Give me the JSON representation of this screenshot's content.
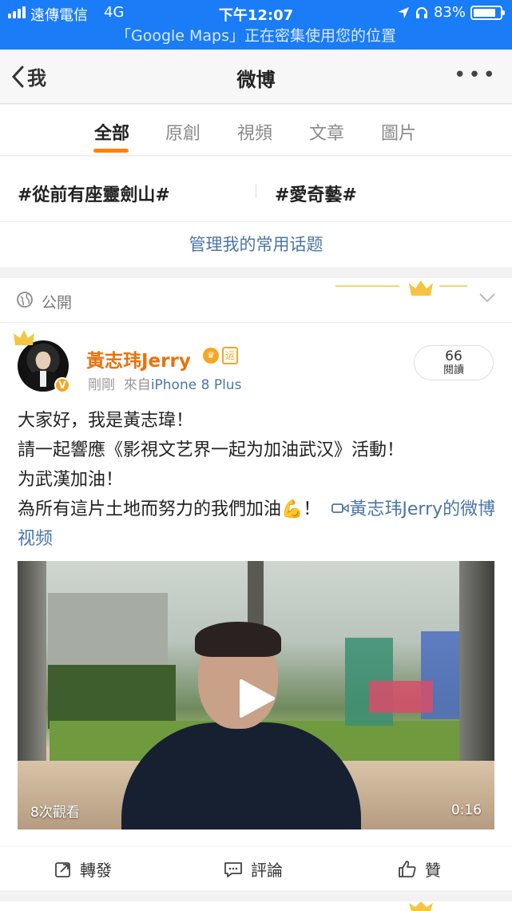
{
  "status_bar": {
    "carrier": "遠傳電信",
    "network": "4G",
    "time": "下午12:07",
    "battery_text": "83%",
    "battery_level": 0.83,
    "location_banner": "「Google Maps」正在密集使用您的位置"
  },
  "nav": {
    "back_label": "我",
    "title": "微博",
    "more": "•••"
  },
  "tabs": [
    {
      "label": "全部",
      "active": true
    },
    {
      "label": "原創",
      "active": false
    },
    {
      "label": "視頻",
      "active": false
    },
    {
      "label": "文章",
      "active": false
    },
    {
      "label": "圖片",
      "active": false
    }
  ],
  "topics": [
    "#從前有座靈劍山#",
    "#愛奇藝#"
  ],
  "manage_topics": "管理我的常用话题",
  "post": {
    "visibility": "公開",
    "author": "黃志玮Jerry",
    "vip_badge": "♛",
    "yun_badge": "运",
    "verified_badge": "V",
    "time": "剛剛",
    "source_prefix": "來自",
    "source": "iPhone 8 Plus",
    "read_count": "66",
    "read_label": "閱讀",
    "text_lines": [
      "大家好，我是黃志瑋！",
      "請一起響應《影視文艺界一起为加油武汉》活動！",
      "为武漢加油！",
      "為所有這片土地而努力的我們加油💪！"
    ],
    "video_link": "黃志玮Jerry的微博视频",
    "video": {
      "views": "8次觀看",
      "duration": "0:16"
    },
    "actions": {
      "repost": "轉發",
      "comment": "評論",
      "like": "贊"
    }
  },
  "colors": {
    "status_bar": "#1a7cf7",
    "accent_orange": "#ff8200",
    "link_blue": "#4a75a8",
    "username_orange": "#e8720c"
  }
}
